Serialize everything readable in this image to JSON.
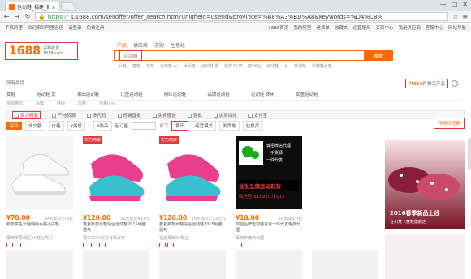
{
  "browser": {
    "tab_title": "运动鞋_福建_莆田_运动鞋",
    "tab_close": "×",
    "window_controls": [
      "—",
      "□",
      "✕"
    ],
    "nav_buttons": [
      "←",
      "→",
      "↻"
    ],
    "url_scheme": "https://",
    "url_rest": "s.1688.com/selloffer/offer_search.htm?uniqfield=userid&province=%B8%A3%BD%A8&keywords=%D4%CB%"
  },
  "topnav": {
    "left": [
      "手机阿里",
      "欢迎来到阿里巴巴",
      "请登录",
      "免费注册"
    ],
    "right": [
      "1688首页",
      "我的阿里",
      "进货单",
      "收藏夹",
      "运营服务",
      "买家中心",
      "我是供应商",
      "客服中心",
      "网站导航"
    ]
  },
  "header": {
    "logo_main": "1688",
    "logo_sub1": "采购批发",
    "logo_sub2": "1688.com",
    "search_tabs": [
      "产品",
      "供应商",
      "求购",
      "生意经"
    ],
    "search_value": "运动鞋",
    "search_button": "搜索",
    "hot_words": [
      "女鞋",
      "童鞋",
      "低帮",
      "运动鞋 女",
      "休闲鞋",
      "运动鞋 男",
      "新款2015",
      "欧洲站",
      "运动鞋",
      "女",
      "旅游鞋",
      "松糕鞋女鞋"
    ]
  },
  "results": {
    "all_categories": "所有类目",
    "count_prefix": "共",
    "count_value": "914",
    "count_suffix": "件相关产品",
    "subcats": [
      "女鞋",
      "运动鞋 女",
      "莆田运动鞋",
      "儿童运动鞋",
      "网红运动鞋",
      "品牌运动鞋",
      "运动鞋 休闲",
      "女童运动鞋"
    ],
    "brands": [
      "货源类型",
      "品牌",
      "鞋码",
      "风格",
      "价格区间"
    ]
  },
  "filters1": [
    "实力商家",
    "产地货源",
    "多代码",
    "旺铺直批",
    "免费赠送",
    "混批",
    "加实描述",
    "支付宝"
  ],
  "filters2": {
    "sort": [
      "综合",
      "成交额",
      "价格"
    ],
    "price_from": "¥最低",
    "price_to": "¥最高",
    "pick": "起订量",
    "loc_label": "以下",
    "loc": "莆田",
    "more": [
      "经营模式",
      "发货地",
      "包换货"
    ]
  },
  "store_button": "存存供应商",
  "products": [
    {
      "badge": "",
      "price": "¥70.00",
      "sold": "30天成交975元",
      "desc": "新款学生女鞋韩版百搭小白鞋",
      "comp": "莆田市荔城区XX鞋业商行"
    },
    {
      "badge": "实力商家",
      "price": "¥120.00",
      "sold": "30天成交411元",
      "desc": "春夏新款女鞋情侣运动鞋2015网面透气",
      "comp": "晋江市XX贸易有限公司"
    },
    {
      "badge": "实力商家",
      "price": "¥120.00",
      "sold": "30天成交2.32万元",
      "desc": "春夏新款女鞋情侣运动鞋2015网面透气",
      "comp": "福建莆田XX鞋业"
    },
    {
      "badge": "",
      "price": "¥10.00",
      "sold": "30天成交0元",
      "desc": "加盟品牌运动鞋货源一件代发免费代理",
      "comp": "莆田市微商代理"
    },
    {
      "badge": "",
      "price": "",
      "sold": "",
      "desc": "",
      "comp": ""
    }
  ],
  "wechat_ad": {
    "line1": "诚招微信代理",
    "line2": "一手货源",
    "line3": "一件代发",
    "line4": "批发品牌运动鞋货",
    "line5": "微信号:a1895071012"
  },
  "right_ad": {
    "title": "2016春季新品上线",
    "sub": "台州梵卡童鞋旗舰店"
  },
  "colors": {
    "accent": "#ff6a00",
    "highlight": "#e4393c"
  }
}
